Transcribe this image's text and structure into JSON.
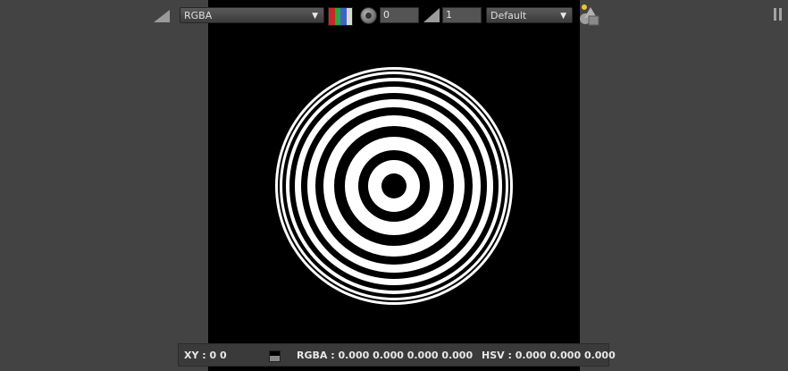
{
  "toolbar": {
    "channel": {
      "value": "RGBA",
      "caret_icon": "chevron-down-icon",
      "channel_colors": [
        "#c42a2a",
        "#2aa83a",
        "#3c62c8",
        "#d8d8d8"
      ]
    },
    "gain": {
      "icon": "aperture-icon",
      "value": "0"
    },
    "gamma": {
      "icon": "gamma-ramp-icon",
      "value": "1"
    },
    "lut": {
      "value": "Default",
      "caret_icon": "chevron-down-icon"
    },
    "scene_icon": "scene-objects-icon",
    "pause_icon": "pause-icon"
  },
  "viewer": {
    "image": "concentric-rings-target",
    "background": "#000000",
    "ring_color": "#ffffff"
  },
  "status": {
    "xy_text": "XY : 0 0",
    "rgba_text": "RGBA : 0.000 0.000 0.000 0.000",
    "hsv_text": "HSV : 0.000 0.000 0.000"
  },
  "colors": {
    "panel_bg": "#434343",
    "statusbar_bg": "#3a3a3a",
    "indicator_dot": "#f1c232"
  }
}
